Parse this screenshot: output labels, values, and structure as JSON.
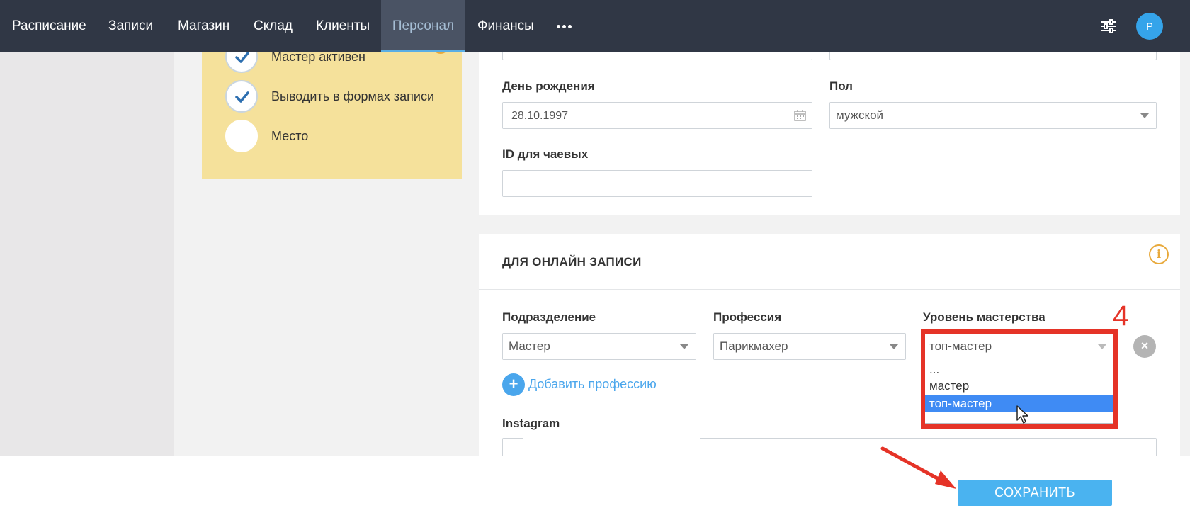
{
  "nav": {
    "items": [
      "Расписание",
      "Записи",
      "Магазин",
      "Склад",
      "Клиенты",
      "Персонал",
      "Финансы"
    ],
    "active": "Персонал",
    "avatar_letter": "P"
  },
  "status_card": {
    "items": [
      {
        "label": "Мастер активен",
        "checked": true
      },
      {
        "label": "Выводить в формах записи",
        "checked": true
      },
      {
        "label": "Место",
        "checked": false
      }
    ]
  },
  "personal": {
    "birthday": {
      "label": "День рождения",
      "value": "28.10.1997"
    },
    "gender": {
      "label": "Пол",
      "value": "мужской"
    },
    "tips_id": {
      "label": "ID для чаевых",
      "value": ""
    }
  },
  "online": {
    "title": "ДЛЯ ОНЛАЙН ЗАПИСИ",
    "department": {
      "label": "Подразделение",
      "value": "Мастер"
    },
    "profession": {
      "label": "Профессия",
      "value": "Парикмахер"
    },
    "level": {
      "label": "Уровень мастерства",
      "value": "топ-мастер",
      "options": [
        "...",
        "мастер",
        "топ-мастер"
      ],
      "selected": "топ-мастер"
    },
    "add_profession": "Добавить профессию",
    "instagram_label": "Instagram"
  },
  "annotation": {
    "step_number": "4",
    "color": "#e53327"
  },
  "footer": {
    "save_label": "СОХРАНИТЬ"
  },
  "colors": {
    "nav_bg": "#303745",
    "accent": "#4ab3f0",
    "card": "#f5e19b",
    "selection": "#3f8bf4"
  }
}
